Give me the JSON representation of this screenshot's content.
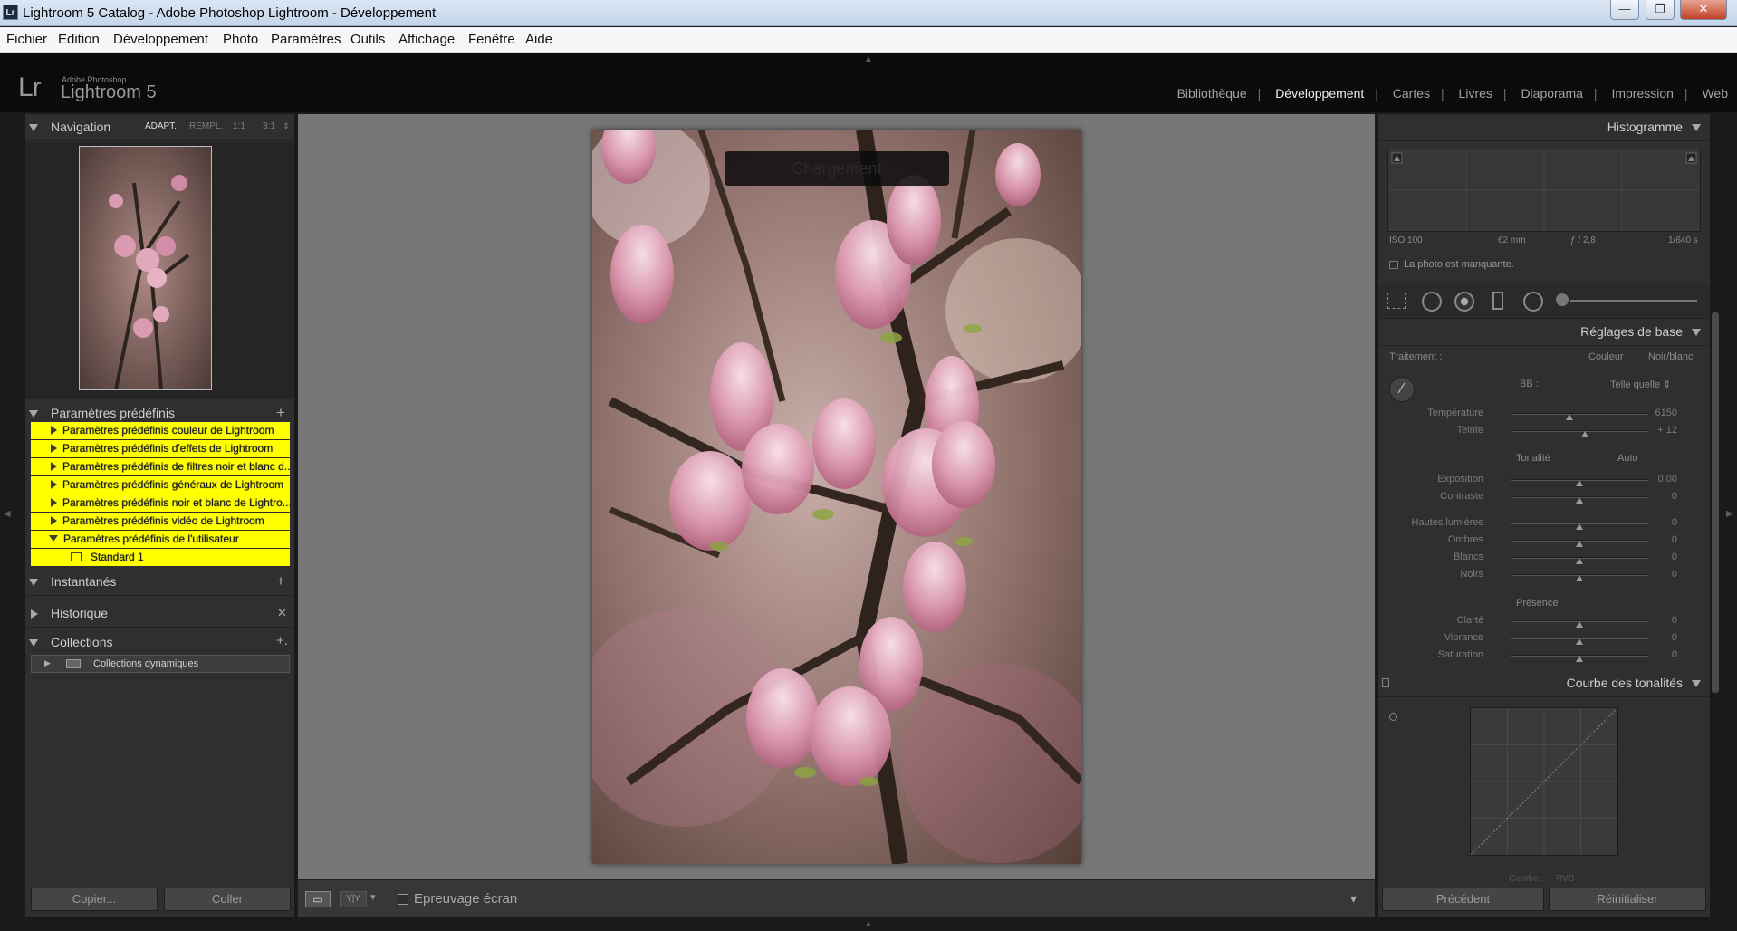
{
  "window": {
    "title": "Lightroom 5 Catalog - Adobe Photoshop Lightroom - Développement",
    "app_icon": "Lr",
    "min_icon": "window-minimize-icon",
    "max_icon": "window-maximize-icon",
    "close_icon": "window-close-icon",
    "min_glyph": "—",
    "max_glyph": "❐",
    "close_glyph": "✕"
  },
  "menu": [
    "Fichier",
    "Edition",
    "Développement",
    "Photo",
    "Paramètres",
    "Outils",
    "Affichage",
    "Fenêtre",
    "Aide"
  ],
  "identity": {
    "lr": "Lr",
    "small": "Adobe Photoshop",
    "big": "Lightroom 5"
  },
  "modules": {
    "items": [
      "Bibliothèque",
      "Développement",
      "Cartes",
      "Livres",
      "Diaporama",
      "Impression",
      "Web"
    ],
    "active_index": 1,
    "separator": "|"
  },
  "navigator": {
    "title": "Navigation",
    "options": [
      "ADAPT.",
      "REMPL.",
      "1:1",
      "3:1"
    ],
    "selected": "ADAPT."
  },
  "presets": {
    "title": "Paramètres prédéfinis",
    "add_glyph": "+",
    "highlight_color": "#ffff00",
    "folders": [
      "Paramètres prédéfinis couleur de Lightroom",
      "Paramètres prédéfinis d'effets de Lightroom",
      "Paramètres prédéfinis de filtres noir et blanc d...",
      "Paramètres prédéfinis généraux de Lightroom",
      "Paramètres prédéfinis noir et blanc de Lightro...",
      "Paramètres prédéfinis vidéo de Lightroom",
      "Paramètres prédéfinis de l'utilisateur"
    ],
    "user_item": "Standard 1"
  },
  "snapshots": {
    "title": "Instantanés",
    "add_glyph": "+"
  },
  "history": {
    "title": "Historique",
    "clear_glyph": "✕"
  },
  "collections": {
    "title": "Collections",
    "add_glyph": "+.",
    "items": [
      "Collections dynamiques"
    ]
  },
  "left_buttons": {
    "copy": "Copier...",
    "paste": "Coller"
  },
  "histogram": {
    "title": "Histogramme",
    "iso": "ISO 100",
    "focal": "62 mm",
    "aperture": "ƒ / 2,8",
    "shutter": "1/640 s",
    "missing": "La photo est manquante."
  },
  "basic": {
    "title": "Réglages de base",
    "treatment_label": "Traitement :",
    "treatment_options": [
      "Couleur",
      "Noir/blanc"
    ],
    "wb_label": "BB :",
    "wb_value": "Telle quelle ⇕",
    "tone_label": "Tonalité",
    "auto_label": "Auto",
    "presence_label": "Présence",
    "wb_sliders": [
      {
        "label": "Température",
        "value": "6150",
        "pos": 0.43
      },
      {
        "label": "Teinte",
        "value": "+ 12",
        "pos": 0.54
      }
    ],
    "tone_sliders": [
      {
        "label": "Exposition",
        "value": "0,00",
        "pos": 0.5
      },
      {
        "label": "Contraste",
        "value": "0",
        "pos": 0.5
      }
    ],
    "light_sliders": [
      {
        "label": "Hautes lumières",
        "value": "0",
        "pos": 0.5
      },
      {
        "label": "Ombres",
        "value": "0",
        "pos": 0.5
      },
      {
        "label": "Blancs",
        "value": "0",
        "pos": 0.5
      },
      {
        "label": "Noirs",
        "value": "0",
        "pos": 0.5
      }
    ],
    "presence_sliders": [
      {
        "label": "Clarté",
        "value": "0",
        "pos": 0.5
      },
      {
        "label": "Vibrance",
        "value": "0",
        "pos": 0.5
      },
      {
        "label": "Saturation",
        "value": "0",
        "pos": 0.5
      }
    ]
  },
  "tone_curve": {
    "title": "Courbe des tonalités",
    "channel_label": "Courbe :",
    "channel_value": "RVB"
  },
  "right_buttons": {
    "previous": "Précédent",
    "reset": "Réinitialiser"
  },
  "toolbar": {
    "proof_label": "Epreuvage écran",
    "view_glyph": "▭",
    "compare_glyph": "Y|Y",
    "dropdown_glyph": "▾"
  },
  "photo": {
    "overlay_text": "Chargement"
  }
}
